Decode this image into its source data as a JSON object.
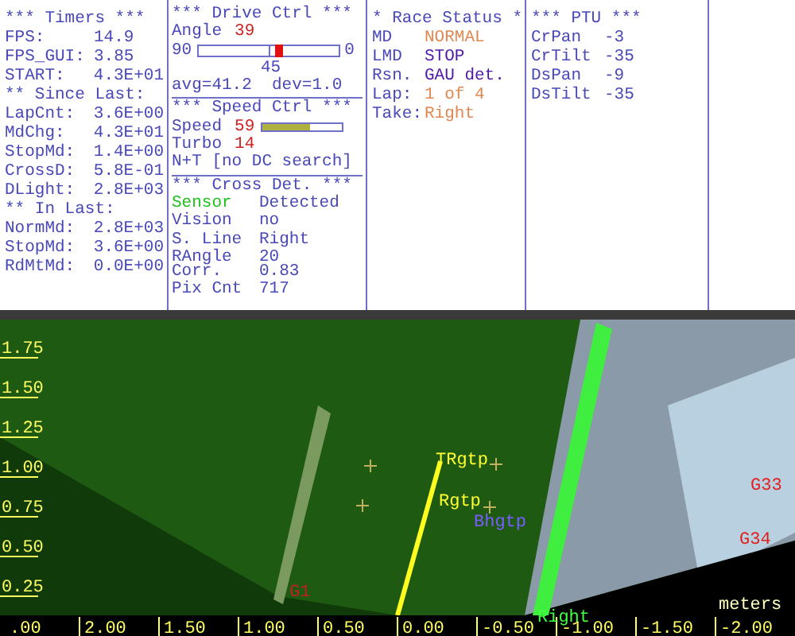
{
  "timers": {
    "title": "*** Timers ***",
    "rows": [
      {
        "kind": "row",
        "label": "FPS:",
        "value": "14.9"
      },
      {
        "kind": "row",
        "label": "FPS_GUI:",
        "value": "3.85"
      },
      {
        "kind": "row",
        "label": "START:",
        "value": "4.3E+01"
      },
      {
        "kind": "heading",
        "label": "** Since Last:"
      },
      {
        "kind": "row",
        "label": "LapCnt:",
        "value": "3.6E+00"
      },
      {
        "kind": "row",
        "label": "MdChg:",
        "value": "4.3E+01"
      },
      {
        "kind": "row",
        "label": "StopMd:",
        "value": "1.4E+00"
      },
      {
        "kind": "row",
        "label": "CrossD:",
        "value": "5.8E-01"
      },
      {
        "kind": "row",
        "label": "DLight:",
        "value": "2.8E+03"
      },
      {
        "kind": "heading",
        "label": "** In Last:"
      },
      {
        "kind": "row",
        "label": "NormMd:",
        "value": "2.8E+03"
      },
      {
        "kind": "row",
        "label": "StopMd:",
        "value": "3.6E+00"
      },
      {
        "kind": "row",
        "label": "RdMtMd:",
        "value": "0.0E+00"
      }
    ]
  },
  "drive_ctrl": {
    "title": "*** Drive Ctrl ***",
    "angle": {
      "label": "Angle",
      "value": "39"
    },
    "slider": {
      "min_label": "90",
      "max_label": "0",
      "center_label": "45",
      "level": 0.57
    },
    "stats": "avg=41.2  dev=1.0"
  },
  "speed_ctrl": {
    "title": "*** Speed Ctrl ***",
    "speed": {
      "label": "Speed",
      "value": "59",
      "level": 0.6
    },
    "turbo": {
      "label": "Turbo",
      "value": "14"
    },
    "mode": "N+T [no DC search]"
  },
  "cross_det": {
    "title": "*** Cross Det. ***",
    "rows": [
      {
        "label": "Sensor",
        "value": "Detected",
        "highlighted": true
      },
      {
        "label": "Vision",
        "value": "no",
        "highlighted": false
      },
      {
        "label": "S. Line",
        "value": "Right",
        "highlighted": false
      },
      {
        "label": "RAngle",
        "value": "20",
        "highlighted": false
      },
      {
        "label": "Corr.",
        "value": "0.83",
        "highlighted": false
      },
      {
        "label": "Pix Cnt",
        "value": "717",
        "highlighted": false
      }
    ]
  },
  "race_status": {
    "title": "* Race Status *",
    "rows": [
      {
        "label": "MD",
        "value": "NORMAL",
        "color": "#e08850"
      },
      {
        "label": "LMD",
        "value": "STOP",
        "color": "#5018a8"
      },
      {
        "label": "Rsn.",
        "value": "GAU det.",
        "color": "#5018a8"
      },
      {
        "label": "Lap:",
        "value": "1 of 4",
        "color": "#e08850"
      },
      {
        "label": "Take:",
        "value": "Right",
        "color": "#e08850"
      }
    ]
  },
  "ptu": {
    "title": "*** PTU ***",
    "rows": [
      {
        "label": "CrPan",
        "value": "-3"
      },
      {
        "label": "CrTilt",
        "value": "-35"
      },
      {
        "label": "DsPan",
        "value": "-9"
      },
      {
        "label": "DsTilt",
        "value": "-35"
      }
    ]
  },
  "camera": {
    "y_labels": [
      "1.75",
      "1.50",
      "1.25",
      "1.00",
      "0.75",
      "0.50",
      "0.25"
    ],
    "x_labels": [
      ".00",
      "2.00",
      "1.50",
      "1.00",
      "0.50",
      "0.00",
      "-0.50",
      "-1.00",
      "-1.50",
      "-2.00"
    ],
    "unit": "meters",
    "markers": [
      {
        "label": "TRgtp",
        "color": "#ffff30"
      },
      {
        "label": "Rgtp",
        "color": "#ffff30"
      },
      {
        "label": "Bhgtp",
        "color": "#7a5cff"
      },
      {
        "label": "G33",
        "color": "#e02020"
      },
      {
        "label": "G34",
        "color": "#e02020"
      },
      {
        "label": "G1",
        "color": "#c02020"
      },
      {
        "label": "Right",
        "color": "#40ff40"
      }
    ]
  }
}
